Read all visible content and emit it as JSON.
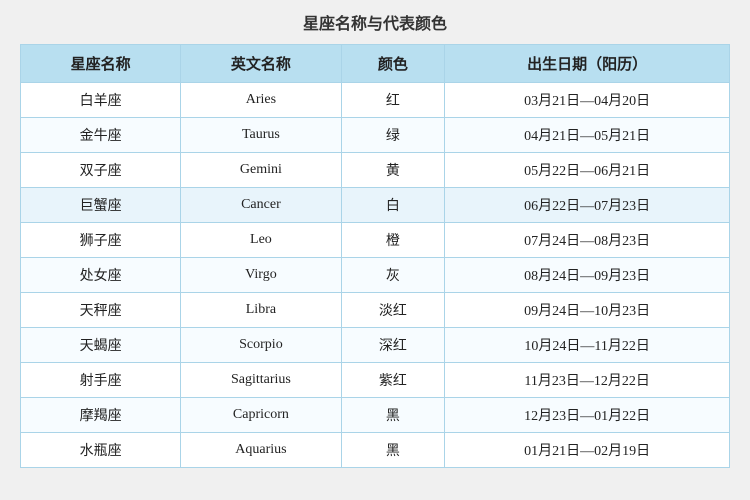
{
  "title": "星座名称与代表颜色",
  "headers": [
    "星座名称",
    "英文名称",
    "颜色",
    "出生日期（阳历）"
  ],
  "rows": [
    {
      "zh": "白羊座",
      "en": "Aries",
      "color": "红",
      "date": "03月21日—04月20日"
    },
    {
      "zh": "金牛座",
      "en": "Taurus",
      "color": "绿",
      "date": "04月21日—05月21日"
    },
    {
      "zh": "双子座",
      "en": "Gemini",
      "color": "黄",
      "date": "05月22日—06月21日"
    },
    {
      "zh": "巨蟹座",
      "en": "Cancer",
      "color": "白",
      "date": "06月22日—07月23日"
    },
    {
      "zh": "狮子座",
      "en": "Leo",
      "color": "橙",
      "date": "07月24日—08月23日"
    },
    {
      "zh": "处女座",
      "en": "Virgo",
      "color": "灰",
      "date": "08月24日—09月23日"
    },
    {
      "zh": "天秤座",
      "en": "Libra",
      "color": "淡红",
      "date": "09月24日—10月23日"
    },
    {
      "zh": "天蝎座",
      "en": "Scorpio",
      "color": "深红",
      "date": "10月24日—11月22日"
    },
    {
      "zh": "射手座",
      "en": "Sagittarius",
      "color": "紫红",
      "date": "11月23日—12月22日"
    },
    {
      "zh": "摩羯座",
      "en": "Capricorn",
      "color": "黑",
      "date": "12月23日—01月22日"
    },
    {
      "zh": "水瓶座",
      "en": "Aquarius",
      "color": "黑",
      "date": "01月21日—02月19日"
    }
  ]
}
